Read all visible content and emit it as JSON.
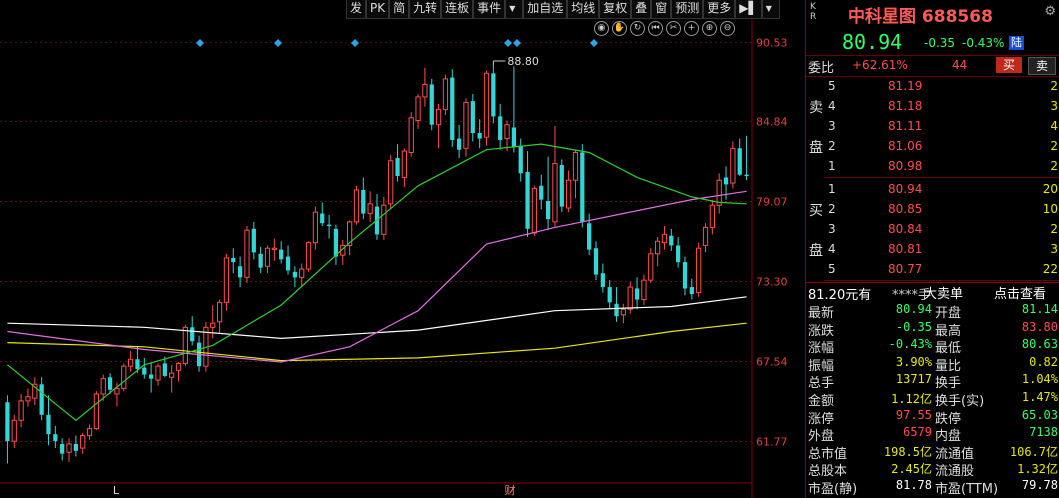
{
  "toolbar": [
    "发",
    "PK",
    "简",
    "九转",
    "连板",
    "事件",
    "▼",
    "加自选",
    "均线",
    "复权",
    "叠",
    "窗",
    "预测",
    "更多",
    "▶▌",
    "▼"
  ],
  "chart_tools": [
    "eye-icon",
    "hand-icon",
    "refresh-icon",
    "rewind-icon",
    "scissors-icon",
    "plus-icon",
    "zoom-in-icon",
    "zoom-out-icon"
  ],
  "chart_data": {
    "type": "candlestick",
    "y_ticks": [
      "90.53",
      "84.84",
      "79.07",
      "73.30",
      "67.54",
      "61.77"
    ],
    "ylim": [
      59.0,
      92.0
    ],
    "max_annotation": "88.80",
    "x_markers": [
      "L",
      "财"
    ],
    "ohlc": [
      [
        64.6,
        65.1,
        60.2,
        61.8
      ],
      [
        61.8,
        63.7,
        61.3,
        63.3
      ],
      [
        63.3,
        65.2,
        62.8,
        64.7
      ],
      [
        64.7,
        65.6,
        64.3,
        65.0
      ],
      [
        64.9,
        66.4,
        64.4,
        65.9
      ],
      [
        65.9,
        66.4,
        63.3,
        63.7
      ],
      [
        63.7,
        65.1,
        61.5,
        62.3
      ],
      [
        62.3,
        62.9,
        61.3,
        61.8
      ],
      [
        61.6,
        62.0,
        60.4,
        60.9
      ],
      [
        61.0,
        62.0,
        60.3,
        61.6
      ],
      [
        61.6,
        62.2,
        60.7,
        61.1
      ],
      [
        61.3,
        62.4,
        60.9,
        62.2
      ],
      [
        62.2,
        63.0,
        61.9,
        62.7
      ],
      [
        62.7,
        65.4,
        62.6,
        65.2
      ],
      [
        65.2,
        66.6,
        64.7,
        66.3
      ],
      [
        66.4,
        66.7,
        65.2,
        65.5
      ],
      [
        65.2,
        66.0,
        64.3,
        65.6
      ],
      [
        65.6,
        67.4,
        65.4,
        67.2
      ],
      [
        67.2,
        68.3,
        66.8,
        67.7
      ],
      [
        67.7,
        68.6,
        66.7,
        67.0
      ],
      [
        67.1,
        67.8,
        66.3,
        66.6
      ],
      [
        66.6,
        67.4,
        65.3,
        66.3
      ],
      [
        66.2,
        67.4,
        65.8,
        67.2
      ],
      [
        67.4,
        67.9,
        66.4,
        66.5
      ],
      [
        66.4,
        67.3,
        65.3,
        66.7
      ],
      [
        66.9,
        67.5,
        66.1,
        67.4
      ],
      [
        67.4,
        70.2,
        67.2,
        70.0
      ],
      [
        70.0,
        70.8,
        68.7,
        69.0
      ],
      [
        68.9,
        69.4,
        66.8,
        67.2
      ],
      [
        67.2,
        70.4,
        66.8,
        70.0
      ],
      [
        70.0,
        71.6,
        69.2,
        70.3
      ],
      [
        70.4,
        72.0,
        69.6,
        71.8
      ],
      [
        71.8,
        75.3,
        71.2,
        75.0
      ],
      [
        75.0,
        75.7,
        73.9,
        74.7
      ],
      [
        74.4,
        75.1,
        72.9,
        73.6
      ],
      [
        73.6,
        77.3,
        73.2,
        77.0
      ],
      [
        77.1,
        77.6,
        74.9,
        75.4
      ],
      [
        75.3,
        75.8,
        73.9,
        74.3
      ],
      [
        74.4,
        75.9,
        73.9,
        75.7
      ],
      [
        75.6,
        76.4,
        74.8,
        75.7
      ],
      [
        75.6,
        76.2,
        74.6,
        74.9
      ],
      [
        75.1,
        75.9,
        73.8,
        74.1
      ],
      [
        74.0,
        74.4,
        72.9,
        73.6
      ],
      [
        73.6,
        74.6,
        73.0,
        74.2
      ],
      [
        74.2,
        76.2,
        74.0,
        76.1
      ],
      [
        76.1,
        78.7,
        75.6,
        78.3
      ],
      [
        78.2,
        79.0,
        77.3,
        77.5
      ],
      [
        77.4,
        78.1,
        76.4,
        77.3
      ],
      [
        77.1,
        77.4,
        74.5,
        75.1
      ],
      [
        75.2,
        76.3,
        74.5,
        75.9
      ],
      [
        75.9,
        77.7,
        75.2,
        77.6
      ],
      [
        77.6,
        80.2,
        77.4,
        79.9
      ],
      [
        79.9,
        80.8,
        77.8,
        78.2
      ],
      [
        78.2,
        79.8,
        77.6,
        78.9
      ],
      [
        78.7,
        79.6,
        76.3,
        76.7
      ],
      [
        76.7,
        79.4,
        76.3,
        78.8
      ],
      [
        78.9,
        82.4,
        78.5,
        82.0
      ],
      [
        82.2,
        83.2,
        80.5,
        80.9
      ],
      [
        80.8,
        82.9,
        80.1,
        82.7
      ],
      [
        82.6,
        85.5,
        82.3,
        85.1
      ],
      [
        84.9,
        86.8,
        84.3,
        86.6
      ],
      [
        86.6,
        88.7,
        85.9,
        87.5
      ],
      [
        87.5,
        87.9,
        84.2,
        84.6
      ],
      [
        84.6,
        86.1,
        82.9,
        85.7
      ],
      [
        85.7,
        88.2,
        85.3,
        87.9
      ],
      [
        88.0,
        88.6,
        83.0,
        83.5
      ],
      [
        83.6,
        84.6,
        82.2,
        82.8
      ],
      [
        82.9,
        86.5,
        82.3,
        86.2
      ],
      [
        86.3,
        86.8,
        83.4,
        84.0
      ],
      [
        84.0,
        85.0,
        82.9,
        83.6
      ],
      [
        83.7,
        88.5,
        83.1,
        88.3
      ],
      [
        88.3,
        88.8,
        84.7,
        85.2
      ],
      [
        85.2,
        86.1,
        82.8,
        83.5
      ],
      [
        83.6,
        84.9,
        82.7,
        84.6
      ],
      [
        84.4,
        88.8,
        82.6,
        83.0
      ],
      [
        83.1,
        83.6,
        80.5,
        81.1
      ],
      [
        81.2,
        82.7,
        76.5,
        77.1
      ],
      [
        76.8,
        80.2,
        76.6,
        80.0
      ],
      [
        80.2,
        81.0,
        78.5,
        79.2
      ],
      [
        79.1,
        82.3,
        77.0,
        77.8
      ],
      [
        77.6,
        84.5,
        77.2,
        81.8
      ],
      [
        81.7,
        82.1,
        78.3,
        78.7
      ],
      [
        78.6,
        81.3,
        78.3,
        80.6
      ],
      [
        80.6,
        82.8,
        79.3,
        82.6
      ],
      [
        82.6,
        83.2,
        77.2,
        77.6
      ],
      [
        77.5,
        78.2,
        75.2,
        75.6
      ],
      [
        75.7,
        76.2,
        73.4,
        73.8
      ],
      [
        73.9,
        74.6,
        72.5,
        72.9
      ],
      [
        72.9,
        73.4,
        71.4,
        71.8
      ],
      [
        71.7,
        72.9,
        70.4,
        70.8
      ],
      [
        70.9,
        71.7,
        70.3,
        71.3
      ],
      [
        71.3,
        73.3,
        71.0,
        72.9
      ],
      [
        72.8,
        73.6,
        71.3,
        72.0
      ],
      [
        72.0,
        73.8,
        71.6,
        73.4
      ],
      [
        73.4,
        75.7,
        73.2,
        75.3
      ],
      [
        75.3,
        76.5,
        74.4,
        76.2
      ],
      [
        76.1,
        77.3,
        75.6,
        76.7
      ],
      [
        76.6,
        77.1,
        75.5,
        75.9
      ],
      [
        75.9,
        76.5,
        74.3,
        74.7
      ],
      [
        74.7,
        75.1,
        72.3,
        72.8
      ],
      [
        72.9,
        73.5,
        72.0,
        72.4
      ],
      [
        72.5,
        76.1,
        72.2,
        75.7
      ],
      [
        75.9,
        77.5,
        75.4,
        77.2
      ],
      [
        77.2,
        79.2,
        76.7,
        78.8
      ],
      [
        78.8,
        81.1,
        78.2,
        80.6
      ],
      [
        80.8,
        81.6,
        79.2,
        80.3
      ],
      [
        80.4,
        83.4,
        80.0,
        82.9
      ],
      [
        82.9,
        83.6,
        80.9,
        81.0
      ],
      [
        81.0,
        83.8,
        80.6,
        80.9
      ]
    ],
    "ma": [
      {
        "color": "#ffffff",
        "values": [
          [
            0,
            70.3
          ],
          [
            20,
            70.0
          ],
          [
            40,
            69.2
          ],
          [
            60,
            69.8
          ],
          [
            80,
            71.2
          ],
          [
            97,
            71.5
          ],
          [
            108,
            72.2
          ]
        ]
      },
      {
        "color": "#e8e800",
        "values": [
          [
            0,
            68.9
          ],
          [
            20,
            68.6
          ],
          [
            40,
            67.6
          ],
          [
            60,
            67.8
          ],
          [
            80,
            68.5
          ],
          [
            97,
            69.7
          ],
          [
            108,
            70.3
          ]
        ]
      },
      {
        "color": "#e070e0",
        "values": [
          [
            0,
            69.7
          ],
          [
            20,
            68.4
          ],
          [
            40,
            67.5
          ],
          [
            50,
            68.6
          ],
          [
            60,
            71.2
          ],
          [
            70,
            76.0
          ],
          [
            80,
            77.2
          ],
          [
            90,
            78.2
          ],
          [
            100,
            79.2
          ],
          [
            108,
            79.8
          ]
        ]
      },
      {
        "color": "#33cc33",
        "values": [
          [
            0,
            67.3
          ],
          [
            10,
            63.3
          ],
          [
            20,
            67.3
          ],
          [
            30,
            68.7
          ],
          [
            40,
            71.6
          ],
          [
            50,
            76.1
          ],
          [
            60,
            80.2
          ],
          [
            70,
            82.8
          ],
          [
            78,
            83.2
          ],
          [
            85,
            82.6
          ],
          [
            92,
            80.8
          ],
          [
            100,
            79.4
          ],
          [
            104,
            79.0
          ],
          [
            108,
            78.9
          ]
        ]
      }
    ]
  },
  "quote": {
    "kr_label": [
      "K",
      "R"
    ],
    "name": "中科星图",
    "code": "688568",
    "last": "80.94",
    "change": "-0.35",
    "change_pct": "-0.43%",
    "badge": "陆",
    "weibi_label": "委比",
    "weibi_pct": "+62.61%",
    "weibi_diff": "44",
    "buy_btn": "买",
    "sell_btn": "卖",
    "sell_side_label": [
      "卖",
      "盘"
    ],
    "buy_side_label": [
      "买",
      "盘"
    ],
    "sell_levels": [
      {
        "lvl": "5",
        "price": "81.19",
        "vol": "2"
      },
      {
        "lvl": "4",
        "price": "81.18",
        "vol": "3"
      },
      {
        "lvl": "3",
        "price": "81.11",
        "vol": "4"
      },
      {
        "lvl": "2",
        "price": "81.06",
        "vol": "2"
      },
      {
        "lvl": "1",
        "price": "80.98",
        "vol": "2"
      }
    ],
    "buy_levels": [
      {
        "lvl": "1",
        "price": "80.94",
        "vol": "20"
      },
      {
        "lvl": "2",
        "price": "80.85",
        "vol": "10"
      },
      {
        "lvl": "3",
        "price": "80.84",
        "vol": "2"
      },
      {
        "lvl": "4",
        "price": "80.81",
        "vol": "3"
      },
      {
        "lvl": "5",
        "price": "80.77",
        "vol": "22"
      }
    ],
    "info_head": {
      "left": "81.20元有",
      "stars": "****手",
      "mid": "大卖单",
      "right": "点击查看"
    },
    "stats": [
      {
        "l1": "最新",
        "v1": "80.94",
        "c1": "green",
        "l2": "开盘",
        "v2": "81.14",
        "c2": "green"
      },
      {
        "l1": "涨跌",
        "v1": "-0.35",
        "c1": "green",
        "l2": "最高",
        "v2": "83.80",
        "c2": "red"
      },
      {
        "l1": "涨幅",
        "v1": "-0.43%",
        "c1": "green",
        "l2": "最低",
        "v2": "80.63",
        "c2": "green"
      },
      {
        "l1": "振幅",
        "v1": "3.90%",
        "c1": "yellow",
        "l2": "量比",
        "v2": "0.82",
        "c2": "yellow"
      },
      {
        "l1": "总手",
        "v1": "13717",
        "c1": "yellow",
        "l2": "换手",
        "v2": "1.04%",
        "c2": "yellow"
      },
      {
        "l1": "金额",
        "v1": "1.12亿",
        "c1": "yellow",
        "l2": "换手(实)",
        "v2": "1.47%",
        "c2": "yellow"
      },
      {
        "l1": "涨停",
        "v1": "97.55",
        "c1": "red",
        "l2": "跌停",
        "v2": "65.03",
        "c2": "green"
      },
      {
        "l1": "外盘",
        "v1": "6579",
        "c1": "red",
        "l2": "内盘",
        "v2": "7138",
        "c2": "green"
      },
      {
        "l1": "总市值",
        "v1": "198.5亿",
        "c1": "yellow",
        "l2": "流通值",
        "v2": "106.7亿",
        "c2": "yellow"
      },
      {
        "l1": "总股本",
        "v1": "2.45亿",
        "c1": "yellow",
        "l2": "流通股",
        "v2": "1.32亿",
        "c2": "yellow"
      },
      {
        "l1": "市盈(静)",
        "v1": "81.78",
        "c1": "white",
        "l2": "市盈(TTM)",
        "v2": "79.78",
        "c2": "white"
      }
    ]
  },
  "colors": {
    "up": "#ff4d4d",
    "down": "#33d6d6",
    "grid": "#5a1414",
    "axis_text": "#e04040",
    "marker": "#2aa6e8"
  }
}
